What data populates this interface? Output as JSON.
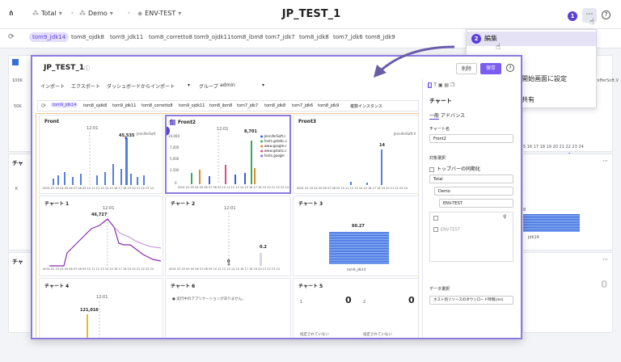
{
  "topbar": {
    "crumb1": "Total",
    "crumb2": "Demo",
    "crumb3": "ENV-TEST",
    "title": "JP_TEST_1",
    "badge1": "1",
    "more": "⋯",
    "help": "?"
  },
  "tags": [
    "tom9_jdk14",
    "tom8_ojdk8",
    "tom9_jdk11",
    "tom8_corretto8",
    "tom9_ojdk11",
    "tom8_ibm8",
    "tom7_jdk7",
    "tom8_jdk8",
    "tom7_jdk6",
    "tom8_jdk9"
  ],
  "menu": {
    "badge2": "2",
    "edit": "編集",
    "set_start": "開始画面に設定",
    "share": "共有"
  },
  "background": {
    "y50k": "50K",
    "y100k": "100K",
    "chart_label_a": "チャ",
    "chart_label_b": "チャ",
    "legend_partial": "nifferSoft.V",
    "axis_partial": "5 16 17 18 19 20 21 22 23 24",
    "tick_k": "K",
    "bar_label": "8",
    "jdk_partial": "jdk14",
    "zero": "0"
  },
  "modal": {
    "title": "JP_TEST_1",
    "delete": "削除",
    "save": "保存",
    "import": "インポート",
    "export": "エクスポート",
    "dash_import": "ダッシュボードからインポート",
    "group": "グループ",
    "group_value": "admin",
    "tags": [
      "tom9_jdk14",
      "tom8_ojdk8",
      "tom9_jdk11",
      "tom8_corretto8",
      "tom9_ojdk11",
      "tom8_ibm8",
      "tom7_jdk7",
      "tom8_jdk8",
      "tom7_jdk6",
      "tom8_jdk9"
    ],
    "multi_instance": "複数インスタンス"
  },
  "charts": {
    "front_title": "Front",
    "front_peak": "45,535",
    "front_time": "12:01",
    "front_legend": "JenniferSoft",
    "front2_title": "Front2",
    "front2_peak": "8,701",
    "front2_time": "12:01",
    "front2_y": [
      "10,000",
      "7,000",
      "5,000",
      "2,500",
      "0"
    ],
    "front2_legend": [
      "JenniferSoft.c",
      "fonts.gstatic.c",
      "www.google.c",
      "www.gstatic.c",
      "fonts.google"
    ],
    "front3_title": "Front3",
    "front3_peak": "14",
    "front3_legend": "JenniferSoft.V",
    "c1_title": "チャート 1",
    "c1_peak": "46,727",
    "c1_time": "12:01",
    "c2_title": "チャート 2",
    "c2_time": "12:01",
    "c2_val": "0.2",
    "c2_zero": "0",
    "c3_title": "チャート 3",
    "c3_val": "60.27",
    "c3_cat": "tom9_jdk14",
    "c4_title": "チャート 4",
    "c4_peak": "121,016",
    "c4_time": "12:01",
    "c6_title": "チャート 6",
    "c6_msg": "実行中のアプリケーションがありません。",
    "c5_title": "チャート 5",
    "c5_a_label": "1",
    "c5_a_val": "0",
    "c5_b_label": "2",
    "c5_b_val": "0",
    "c5_unset1": "指定されていない",
    "c5_unset2": "指定されていない",
    "badge3": "3",
    "axis_hours": "0001 02 03 04 05 06 07 08 09 10 11 12 13 14 15 16 17 18 19 20 21 22 23 24"
  },
  "panel": {
    "header": "チャート",
    "tab_general": "一般",
    "tab_advanced": "アドバンス",
    "name_label": "チャート名",
    "name_value": "Front2",
    "target_label": "対象選択",
    "sync_label": "トップバーの同期化",
    "total": "Total",
    "demo": "Demo",
    "env": "ENV-TEST",
    "env_item": "ENV-TEST",
    "data_label": "データ選択",
    "data_value": "ホスト別リソースのダウンロード時間(ms)"
  },
  "chart_data": [
    {
      "type": "bar",
      "title": "Front",
      "series": [
        {
          "name": "JenniferSoft",
          "values": [
            45535
          ]
        }
      ]
    },
    {
      "type": "bar",
      "title": "Front2",
      "ylim": [
        0,
        10000
      ],
      "series": [
        {
          "name": "JenniferSoft.c",
          "values": [
            8701
          ]
        }
      ]
    },
    {
      "type": "bar",
      "title": "チャート 3",
      "categories": [
        "tom9_jdk14"
      ],
      "values": [
        60.27
      ]
    },
    {
      "type": "bar",
      "title": "チャート 4",
      "values": [
        121016
      ]
    }
  ]
}
